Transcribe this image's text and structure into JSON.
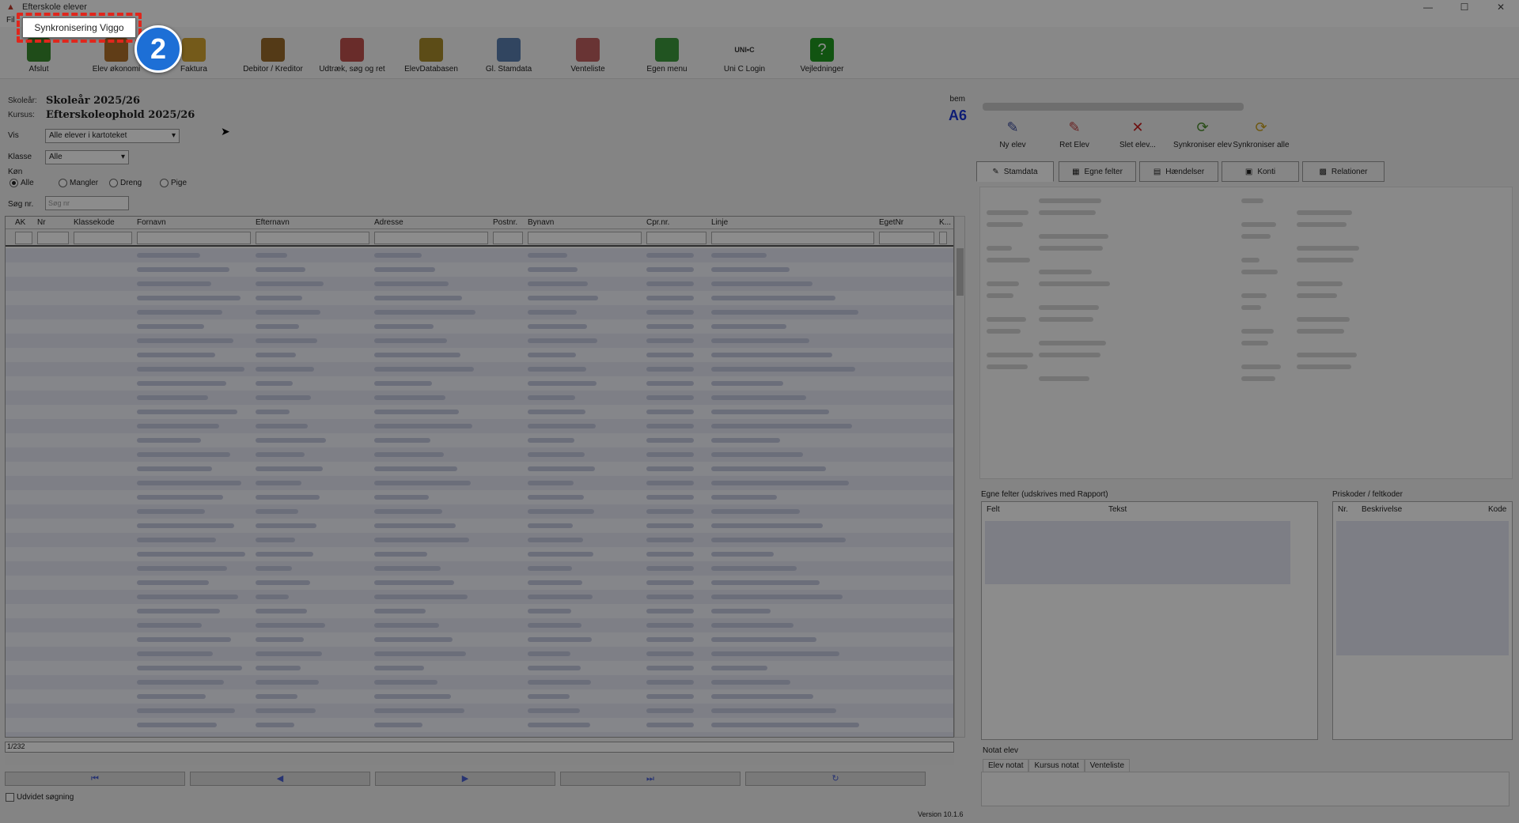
{
  "window": {
    "title": "Efterskole elever",
    "minimize": "—",
    "maximize": "☐",
    "close": "✕"
  },
  "menu": {
    "file": "Fil"
  },
  "toolbar": [
    {
      "label": "Afslut",
      "icon": "exit-icon",
      "color": "#3a8a2f"
    },
    {
      "label": "Elev økonomi",
      "icon": "economy-icon",
      "color": "#b0702a"
    },
    {
      "label": "Faktura",
      "icon": "invoice-icon",
      "color": "#d4a530"
    },
    {
      "label": "Debitor / Kreditor",
      "icon": "debtor-icon",
      "color": "#9a6b2a"
    },
    {
      "label": "Udtræk, søg og ret",
      "icon": "extract-icon",
      "color": "#c0504d"
    },
    {
      "label": "ElevDatabasen",
      "icon": "database-icon",
      "color": "#a88a2a"
    },
    {
      "label": "Gl. Stamdata",
      "icon": "print-icon",
      "color": "#5a7fb0"
    },
    {
      "label": "Venteliste",
      "icon": "clipboard-icon",
      "color": "#c06060"
    },
    {
      "label": "Egen menu",
      "icon": "check-icon",
      "color": "#3c9a3c"
    },
    {
      "label": "Uni C Login",
      "icon": "unic-icon",
      "color": "#444444",
      "text": "UNI•C"
    },
    {
      "label": "Vejledninger",
      "icon": "help-icon",
      "color": "#1f9a1f",
      "text": "?"
    }
  ],
  "info": {
    "school_year_label": "Skoleår:",
    "school_year": "Skoleår 2025/26",
    "course_label": "Kursus:",
    "course": "Efterskoleophold 2025/26",
    "bem_label": "bem",
    "bem_value": "A6"
  },
  "filters": {
    "vis_label": "Vis",
    "vis_value": "Alle elever i kartoteket",
    "klasse_label": "Klasse",
    "klasse_value": "Alle",
    "kon_label": "Køn",
    "kon_options": [
      "Alle",
      "Mangler",
      "Dreng",
      "Pige"
    ],
    "search_label": "Søg nr.",
    "search_placeholder": "Søg nr"
  },
  "grid": {
    "columns": [
      "AK",
      "Nr",
      "Klassekode",
      "Fornavn",
      "Efternavn",
      "Adresse",
      "Postnr.",
      "Bynavn",
      "Cpr.nr.",
      "Linje",
      "EgetNr",
      "K..."
    ],
    "record_info": "1/232"
  },
  "nav": {
    "first": "⏮",
    "prev": "◀",
    "next": "▶",
    "last": "⏭",
    "refresh": "↻"
  },
  "udvidet": "Udvidet søgning",
  "right": {
    "buttons": [
      {
        "label": "Ny elev",
        "icon": "new-student-icon",
        "glyph": "✎",
        "color": "#3a4a9a"
      },
      {
        "label": "Ret Elev",
        "icon": "edit-student-icon",
        "glyph": "✎",
        "color": "#c04040"
      },
      {
        "label": "Slet elev...",
        "icon": "delete-icon",
        "glyph": "✕",
        "color": "#c81e1e"
      },
      {
        "label": "Synkroniser elev",
        "icon": "sync-student-icon",
        "glyph": "⟳",
        "color": "#4a8a2a"
      },
      {
        "label": "Synkroniser alle",
        "icon": "sync-all-icon",
        "glyph": "⟳",
        "color": "#c8a020"
      }
    ],
    "tabs": [
      "Stamdata",
      "Egne felter",
      "Hændelser",
      "Konti",
      "Relationer"
    ],
    "egne_felter_label": "Egne felter (udskrives med Rapport)",
    "egne_cols": [
      "Felt",
      "Tekst"
    ],
    "priskoder_label": "Priskoder / feltkoder",
    "pris_cols": [
      "Nr.",
      "Beskrivelse",
      "Kode"
    ],
    "notat_label": "Notat elev",
    "note_tabs": [
      "Elev notat",
      "Kursus notat",
      "Venteliste"
    ],
    "version": "Version 10.1.6"
  },
  "overlay": {
    "tooltip": "Synkronisering Viggo",
    "badge": "2"
  }
}
